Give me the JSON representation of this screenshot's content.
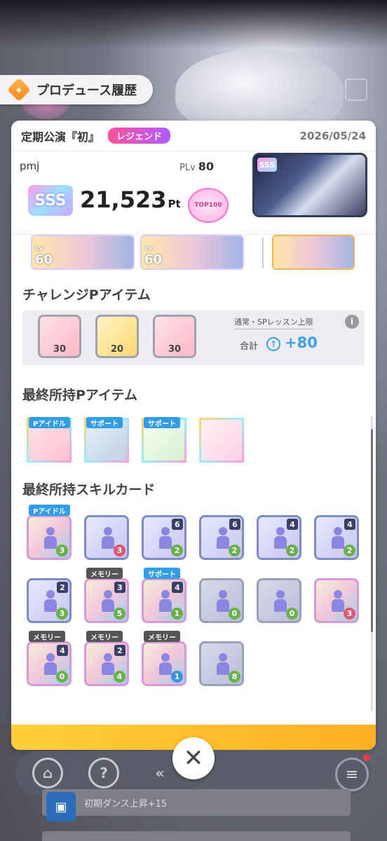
{
  "header": {
    "title": "プロデュース履歴",
    "logo_icon": "produce-logo-icon"
  },
  "performance": {
    "name": "定期公演『初』",
    "difficulty": "レジェンド",
    "date": "2026/05/24"
  },
  "summary": {
    "user_name": "pmj",
    "plv_label": "PLv",
    "plv_value": "80",
    "rank": "SSS",
    "score": "21,523",
    "score_unit": "Pt",
    "top_badge": "TOP100"
  },
  "support_cards": [
    {
      "lv_label": "Lv",
      "lv": "60"
    },
    {
      "lv_label": "Lv",
      "lv": "60"
    }
  ],
  "challenge": {
    "title": "チャレンジPアイテム",
    "items": [
      {
        "cost": "30"
      },
      {
        "cost": "20"
      },
      {
        "cost": "30"
      }
    ],
    "limit_label": "通常・SPレッスン上限",
    "total_label": "合計",
    "total_value": "+80"
  },
  "final_items": {
    "title": "最終所持Pアイテム",
    "items": [
      {
        "tag": "Pアイドル",
        "icon": "feather-icon"
      },
      {
        "tag": "サポート",
        "icon": "tray-icon"
      },
      {
        "tag": "サポート",
        "icon": "greenhouse-icon"
      },
      {
        "tag": "",
        "icon": "figure-icon"
      }
    ]
  },
  "skill_cards": {
    "title": "最終所持スキルカード",
    "rows": [
      [
        {
          "tag": "Pアイドル",
          "cost": "",
          "value": "3",
          "value_color": "green",
          "style": "rainbow"
        },
        {
          "tag": "",
          "cost": "",
          "value": "3",
          "value_color": "red",
          "style": "normal"
        },
        {
          "tag": "",
          "cost": "6",
          "value": "2",
          "value_color": "green",
          "style": "normal"
        },
        {
          "tag": "",
          "cost": "6",
          "value": "2",
          "value_color": "green",
          "style": "normal"
        },
        {
          "tag": "",
          "cost": "4",
          "value": "2",
          "value_color": "green",
          "style": "normal"
        },
        {
          "tag": "",
          "cost": "4",
          "value": "2",
          "value_color": "green",
          "style": "normal"
        }
      ],
      [
        {
          "tag": "",
          "cost": "2",
          "value": "3",
          "value_color": "green",
          "style": "normal"
        },
        {
          "tag": "メモリー",
          "cost": "3",
          "value": "5",
          "value_color": "green",
          "style": "rainbow"
        },
        {
          "tag": "サポート",
          "cost": "4",
          "value": "1",
          "value_color": "green",
          "style": "rainbow"
        },
        {
          "tag": "",
          "cost": "",
          "value": "0",
          "value_color": "green",
          "style": "grey"
        },
        {
          "tag": "",
          "cost": "",
          "value": "0",
          "value_color": "green",
          "style": "grey"
        },
        {
          "tag": "",
          "cost": "",
          "value": "3",
          "value_color": "red",
          "style": "rainbow"
        }
      ],
      [
        {
          "tag": "メモリー",
          "cost": "4",
          "value": "0",
          "value_color": "green",
          "style": "rainbow"
        },
        {
          "tag": "メモリー",
          "cost": "2",
          "value": "4",
          "value_color": "green",
          "style": "rainbow"
        },
        {
          "tag": "メモリー",
          "cost": "",
          "value": "1",
          "value_color": "blue",
          "style": "rainbow"
        },
        {
          "tag": "",
          "cost": "",
          "value": "8",
          "value_color": "green",
          "style": "grey"
        }
      ]
    ]
  },
  "bottom": {
    "close_icon": "close-icon",
    "mission_text": "初期ダンス上昇+15"
  },
  "colors": {
    "accent": "#3ea0e8",
    "legend_badge": "#ff4f9a",
    "card_bottom": "#ffb020"
  }
}
